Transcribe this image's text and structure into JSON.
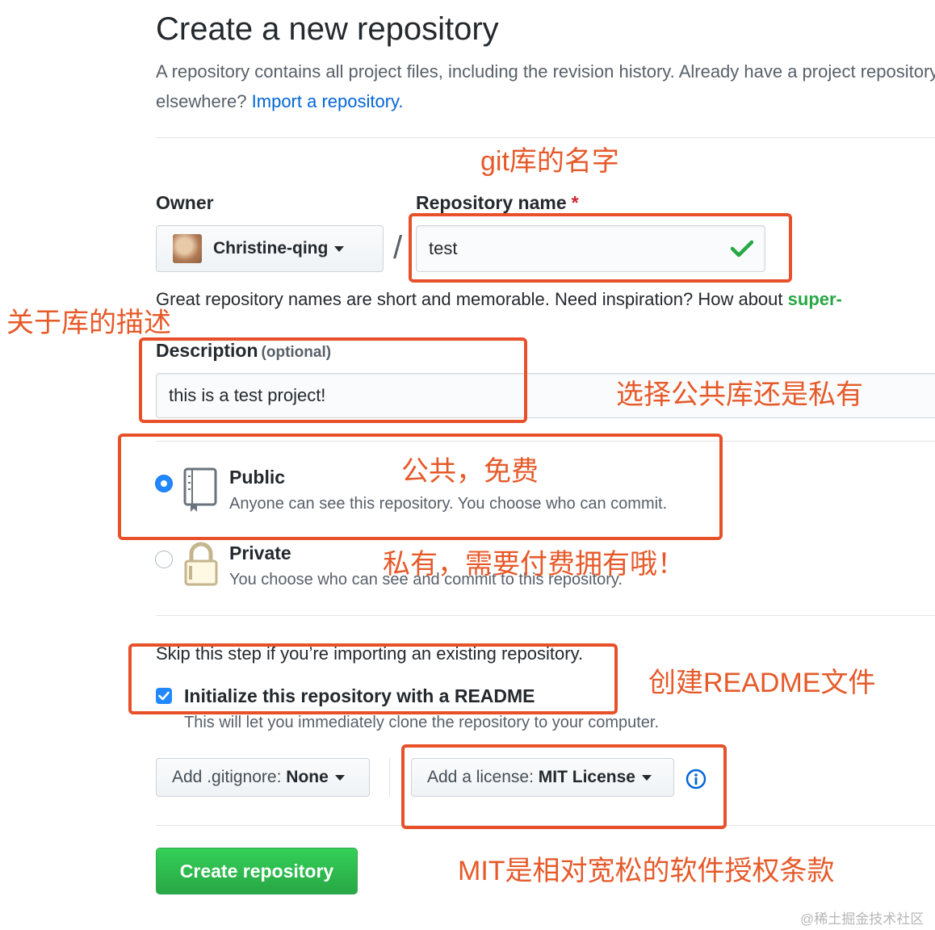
{
  "page": {
    "title": "Create a new repository",
    "subtitle_text": "A repository contains all project files, including the revision history. Already have a project repository",
    "subtitle_line2": "elsewhere?",
    "import_link": "Import a repository."
  },
  "owner": {
    "label": "Owner",
    "value": "Christine-qing"
  },
  "repo_name": {
    "label": "Repository name",
    "required_mark": "*",
    "value": "test"
  },
  "hint": {
    "text": "Great repository names are short and memorable. Need inspiration? How about",
    "suggestion": "super-"
  },
  "description": {
    "label": "Description",
    "optional": "(optional)",
    "value": "this is a test project!"
  },
  "visibility": {
    "public": {
      "title": "Public",
      "desc": "Anyone can see this repository. You choose who can commit.",
      "selected": true
    },
    "private": {
      "title": "Private",
      "desc": "You choose who can see and commit to this repository.",
      "selected": false
    }
  },
  "init": {
    "skip_text": "Skip this step if you’re importing an existing repository.",
    "readme_label": "Initialize this repository with a README",
    "readme_checked": true,
    "readme_desc": "This will let you immediately clone the repository to your computer."
  },
  "gitignore": {
    "prefix": "Add .gitignore:",
    "value": "None"
  },
  "license": {
    "prefix": "Add a license:",
    "value": "MIT License"
  },
  "create_button": "Create repository",
  "annotations": {
    "repo_name_note": "git库的名字",
    "description_note": "关于库的描述",
    "visibility_note": "选择公共库还是私有",
    "public_note": "公共，免费",
    "private_note": "私有，需要付费拥有哦！",
    "readme_note": "创建README文件",
    "license_note": "MIT是相对宽松的软件授权条款"
  },
  "watermark": "@稀土掘金技术社区",
  "colors": {
    "link": "#0366d6",
    "annotation": "#e65a2a",
    "green_button": "#2ea44f",
    "radio_selected": "#2188ff"
  }
}
